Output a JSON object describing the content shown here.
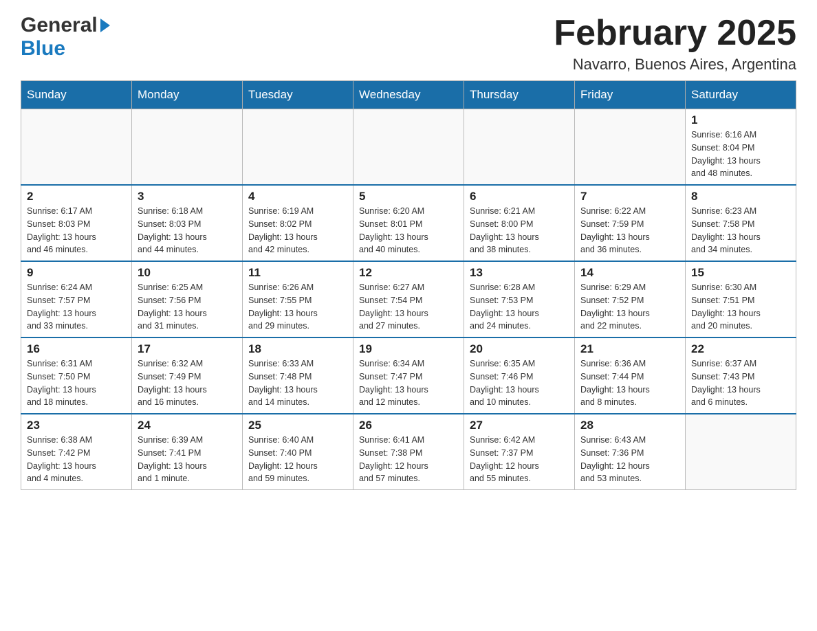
{
  "header": {
    "logo_general": "General",
    "logo_blue": "Blue",
    "month_title": "February 2025",
    "location": "Navarro, Buenos Aires, Argentina"
  },
  "days_of_week": [
    "Sunday",
    "Monday",
    "Tuesday",
    "Wednesday",
    "Thursday",
    "Friday",
    "Saturday"
  ],
  "weeks": [
    [
      {
        "day": "",
        "info": ""
      },
      {
        "day": "",
        "info": ""
      },
      {
        "day": "",
        "info": ""
      },
      {
        "day": "",
        "info": ""
      },
      {
        "day": "",
        "info": ""
      },
      {
        "day": "",
        "info": ""
      },
      {
        "day": "1",
        "info": "Sunrise: 6:16 AM\nSunset: 8:04 PM\nDaylight: 13 hours\nand 48 minutes."
      }
    ],
    [
      {
        "day": "2",
        "info": "Sunrise: 6:17 AM\nSunset: 8:03 PM\nDaylight: 13 hours\nand 46 minutes."
      },
      {
        "day": "3",
        "info": "Sunrise: 6:18 AM\nSunset: 8:03 PM\nDaylight: 13 hours\nand 44 minutes."
      },
      {
        "day": "4",
        "info": "Sunrise: 6:19 AM\nSunset: 8:02 PM\nDaylight: 13 hours\nand 42 minutes."
      },
      {
        "day": "5",
        "info": "Sunrise: 6:20 AM\nSunset: 8:01 PM\nDaylight: 13 hours\nand 40 minutes."
      },
      {
        "day": "6",
        "info": "Sunrise: 6:21 AM\nSunset: 8:00 PM\nDaylight: 13 hours\nand 38 minutes."
      },
      {
        "day": "7",
        "info": "Sunrise: 6:22 AM\nSunset: 7:59 PM\nDaylight: 13 hours\nand 36 minutes."
      },
      {
        "day": "8",
        "info": "Sunrise: 6:23 AM\nSunset: 7:58 PM\nDaylight: 13 hours\nand 34 minutes."
      }
    ],
    [
      {
        "day": "9",
        "info": "Sunrise: 6:24 AM\nSunset: 7:57 PM\nDaylight: 13 hours\nand 33 minutes."
      },
      {
        "day": "10",
        "info": "Sunrise: 6:25 AM\nSunset: 7:56 PM\nDaylight: 13 hours\nand 31 minutes."
      },
      {
        "day": "11",
        "info": "Sunrise: 6:26 AM\nSunset: 7:55 PM\nDaylight: 13 hours\nand 29 minutes."
      },
      {
        "day": "12",
        "info": "Sunrise: 6:27 AM\nSunset: 7:54 PM\nDaylight: 13 hours\nand 27 minutes."
      },
      {
        "day": "13",
        "info": "Sunrise: 6:28 AM\nSunset: 7:53 PM\nDaylight: 13 hours\nand 24 minutes."
      },
      {
        "day": "14",
        "info": "Sunrise: 6:29 AM\nSunset: 7:52 PM\nDaylight: 13 hours\nand 22 minutes."
      },
      {
        "day": "15",
        "info": "Sunrise: 6:30 AM\nSunset: 7:51 PM\nDaylight: 13 hours\nand 20 minutes."
      }
    ],
    [
      {
        "day": "16",
        "info": "Sunrise: 6:31 AM\nSunset: 7:50 PM\nDaylight: 13 hours\nand 18 minutes."
      },
      {
        "day": "17",
        "info": "Sunrise: 6:32 AM\nSunset: 7:49 PM\nDaylight: 13 hours\nand 16 minutes."
      },
      {
        "day": "18",
        "info": "Sunrise: 6:33 AM\nSunset: 7:48 PM\nDaylight: 13 hours\nand 14 minutes."
      },
      {
        "day": "19",
        "info": "Sunrise: 6:34 AM\nSunset: 7:47 PM\nDaylight: 13 hours\nand 12 minutes."
      },
      {
        "day": "20",
        "info": "Sunrise: 6:35 AM\nSunset: 7:46 PM\nDaylight: 13 hours\nand 10 minutes."
      },
      {
        "day": "21",
        "info": "Sunrise: 6:36 AM\nSunset: 7:44 PM\nDaylight: 13 hours\nand 8 minutes."
      },
      {
        "day": "22",
        "info": "Sunrise: 6:37 AM\nSunset: 7:43 PM\nDaylight: 13 hours\nand 6 minutes."
      }
    ],
    [
      {
        "day": "23",
        "info": "Sunrise: 6:38 AM\nSunset: 7:42 PM\nDaylight: 13 hours\nand 4 minutes."
      },
      {
        "day": "24",
        "info": "Sunrise: 6:39 AM\nSunset: 7:41 PM\nDaylight: 13 hours\nand 1 minute."
      },
      {
        "day": "25",
        "info": "Sunrise: 6:40 AM\nSunset: 7:40 PM\nDaylight: 12 hours\nand 59 minutes."
      },
      {
        "day": "26",
        "info": "Sunrise: 6:41 AM\nSunset: 7:38 PM\nDaylight: 12 hours\nand 57 minutes."
      },
      {
        "day": "27",
        "info": "Sunrise: 6:42 AM\nSunset: 7:37 PM\nDaylight: 12 hours\nand 55 minutes."
      },
      {
        "day": "28",
        "info": "Sunrise: 6:43 AM\nSunset: 7:36 PM\nDaylight: 12 hours\nand 53 minutes."
      },
      {
        "day": "",
        "info": ""
      }
    ]
  ]
}
